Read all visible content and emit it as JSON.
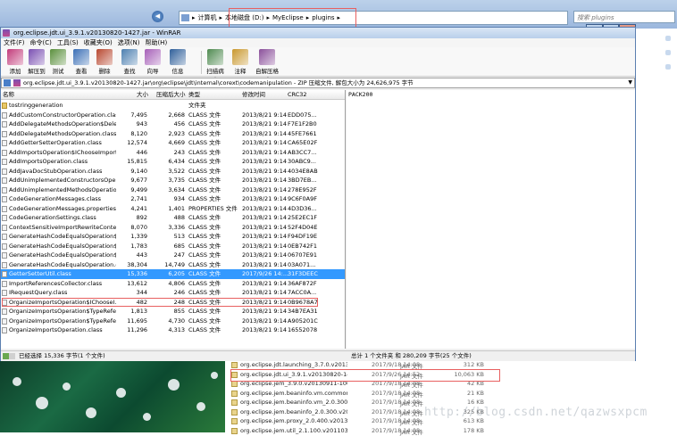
{
  "explorer": {
    "breadcrumb": [
      "计算机",
      "本地磁盘 (D:)",
      "MyEclipse",
      "plugins"
    ],
    "search_placeholder": "搜索 plugins",
    "status_line": "",
    "files": [
      {
        "name": "org.eclipse.jdt.launching_3.7.0.v20130...",
        "date": "2017/9/18 14:08",
        "type": "JAR 文件",
        "size": "312 KB"
      },
      {
        "name": "org.eclipse.jdt.ui_3.9.1.v20130820-14...",
        "date": "2017/9/26 14:52",
        "type": "JAR 文件",
        "size": "10,063 KB"
      },
      {
        "name": "org.eclipse.jem_3.9.0.v20130911-1000...",
        "date": "2017/9/18 14:08",
        "type": "JAR 文件",
        "size": "42 KB"
      },
      {
        "name": "org.eclipse.jem.beaninfo.vm.common...",
        "date": "2017/9/18 14:08",
        "type": "JAR 文件",
        "size": "21 KB"
      },
      {
        "name": "org.eclipse.jem.beaninfo.vm_2.0.300.v...",
        "date": "2017/9/18 14:08",
        "type": "JAR 文件",
        "size": "16 KB"
      },
      {
        "name": "org.eclipse.jem.beaninfo_2.0.300.v20...",
        "date": "2017/9/18 14:08",
        "type": "JAR 文件",
        "size": "325 KB"
      },
      {
        "name": "org.eclipse.jem.proxy_2.0.400.v2013...",
        "date": "2017/9/18 14:08",
        "type": "JAR 文件",
        "size": "613 KB"
      },
      {
        "name": "org.eclipse.jem.util_2.1.100.v201103...",
        "date": "2017/9/18 14:08",
        "type": "JAR 文件",
        "size": "178 KB"
      }
    ],
    "watermark": "http://blog.csdn.net/qazwsxpcm"
  },
  "rar": {
    "title": "org.eclipse.jdt.ui_3.9.1.v20130820-1427.jar - WinRAR",
    "menu": [
      "文件(F)",
      "命令(C)",
      "工具(S)",
      "收藏夹(O)",
      "选项(N)",
      "帮助(H)"
    ],
    "toolbar": [
      {
        "label": "添加",
        "color": "#c23b7a"
      },
      {
        "label": "解压到",
        "color": "#7a4fb2"
      },
      {
        "label": "测试",
        "color": "#5a8f3c"
      },
      {
        "label": "查看",
        "color": "#3b6fb6"
      },
      {
        "label": "删除",
        "color": "#b8472f"
      },
      {
        "label": "查找",
        "color": "#4c7fb0"
      },
      {
        "label": "向导",
        "color": "#a65fb8"
      },
      {
        "label": "信息",
        "color": "#2f5f9a"
      },
      {
        "label": "扫描病毒",
        "color": "#4f8a50"
      },
      {
        "label": "注释",
        "color": "#c9982e"
      },
      {
        "label": "自解压格式",
        "color": "#8a4f9a"
      }
    ],
    "path": "org.eclipse.jdt.ui_3.9.1.v20130820-1427.jar\\org\\eclipse\\jdt\\internal\\corext\\codemanipulation - ZIP 压缩文件, 解包大小为 24,626,975 字节",
    "columns": {
      "name": "名称",
      "size": "大小",
      "packed": "压缩后大小",
      "type": "类型",
      "modified": "修改时间",
      "crc": "CRC32"
    },
    "rows": [
      {
        "name": "tostringgeneration",
        "size": "",
        "packed": "",
        "type": "文件夹",
        "modified": "",
        "crc": "",
        "folder": true
      },
      {
        "name": "AddCustomConstructorOperation.class",
        "size": "7,495",
        "packed": "2,668",
        "type": "CLASS 文件",
        "modified": "2013/8/21 9:14",
        "crc": "EDD075..."
      },
      {
        "name": "AddDelegateMethodsOperation$Dele...",
        "size": "943",
        "packed": "456",
        "type": "CLASS 文件",
        "modified": "2013/8/21 9:14",
        "crc": "F7E1F2B0"
      },
      {
        "name": "AddDelegateMethodsOperation.class",
        "size": "8,120",
        "packed": "2,923",
        "type": "CLASS 文件",
        "modified": "2013/8/21 9:14",
        "crc": "45FE7661"
      },
      {
        "name": "AddGetterSetterOperation.class",
        "size": "12,574",
        "packed": "4,669",
        "type": "CLASS 文件",
        "modified": "2013/8/21 9:14",
        "crc": "CA65E02F"
      },
      {
        "name": "AddImportsOperation$IChooseImport...",
        "size": "446",
        "packed": "243",
        "type": "CLASS 文件",
        "modified": "2013/8/21 9:14",
        "crc": "AB3CC7..."
      },
      {
        "name": "AddImportsOperation.class",
        "size": "15,815",
        "packed": "6,434",
        "type": "CLASS 文件",
        "modified": "2013/8/21 9:14",
        "crc": "30ABC9..."
      },
      {
        "name": "AddJavaDocStubOperation.class",
        "size": "9,140",
        "packed": "3,522",
        "type": "CLASS 文件",
        "modified": "2013/8/21 9:14",
        "crc": "4034E8AB"
      },
      {
        "name": "AddUnimplementedConstructorsOper...",
        "size": "9,677",
        "packed": "3,735",
        "type": "CLASS 文件",
        "modified": "2013/8/21 9:14",
        "crc": "3BD7EB..."
      },
      {
        "name": "AddUnimplementedMethodsOperatio...",
        "size": "9,499",
        "packed": "3,634",
        "type": "CLASS 文件",
        "modified": "2013/8/21 9:14",
        "crc": "278E952F"
      },
      {
        "name": "CodeGenerationMessages.class",
        "size": "2,741",
        "packed": "934",
        "type": "CLASS 文件",
        "modified": "2013/8/21 9:14",
        "crc": "9C6F0A9F"
      },
      {
        "name": "CodeGenerationMessages.properties",
        "size": "4,241",
        "packed": "1,401",
        "type": "PROPERTIES 文件",
        "modified": "2013/8/21 9:14",
        "crc": "4D3D36..."
      },
      {
        "name": "CodeGenerationSettings.class",
        "size": "892",
        "packed": "488",
        "type": "CLASS 文件",
        "modified": "2013/8/21 9:14",
        "crc": "25E2EC1F"
      },
      {
        "name": "ContextSensitiveImportRewriteContext...",
        "size": "8,070",
        "packed": "3,336",
        "type": "CLASS 文件",
        "modified": "2013/8/21 9:14",
        "crc": "52F4D04E"
      },
      {
        "name": "GenerateHashCodeEqualsOperation$1...",
        "size": "1,339",
        "packed": "513",
        "type": "CLASS 文件",
        "modified": "2013/8/21 9:14",
        "crc": "F94DF19E"
      },
      {
        "name": "GenerateHashCodeEqualsOperation$2...",
        "size": "1,783",
        "packed": "685",
        "type": "CLASS 文件",
        "modified": "2013/8/21 9:14",
        "crc": "0EB742F1"
      },
      {
        "name": "GenerateHashCodeEqualsOperation$1...",
        "size": "443",
        "packed": "247",
        "type": "CLASS 文件",
        "modified": "2013/8/21 9:14",
        "crc": "06707E91"
      },
      {
        "name": "GenerateHashCodeEqualsOperation.cl...",
        "size": "38,304",
        "packed": "14,749",
        "type": "CLASS 文件",
        "modified": "2013/8/21 9:14",
        "crc": "03A071..."
      },
      {
        "name": "GetterSetterUtil.class",
        "size": "15,336",
        "packed": "6,205",
        "type": "CLASS 文件",
        "modified": "2017/9/26 14:...",
        "crc": "31F3DEEC",
        "selected": true
      },
      {
        "name": "ImportReferencesCollector.class",
        "size": "13,612",
        "packed": "4,806",
        "type": "CLASS 文件",
        "modified": "2013/8/21 9:14",
        "crc": "36AF872F"
      },
      {
        "name": "IRequestQuery.class",
        "size": "344",
        "packed": "246",
        "type": "CLASS 文件",
        "modified": "2013/8/21 9:14",
        "crc": "7ACC0A..."
      },
      {
        "name": "OrganizeImportsOperation$IChooseI...",
        "size": "482",
        "packed": "248",
        "type": "CLASS 文件",
        "modified": "2013/8/21 9:14",
        "crc": "0B9678A7"
      },
      {
        "name": "OrganizeImportsOperation$TypeRefer...",
        "size": "1,813",
        "packed": "855",
        "type": "CLASS 文件",
        "modified": "2013/8/21 9:14",
        "crc": "34B7EA31"
      },
      {
        "name": "OrganizeImportsOperation$TypeRefer...",
        "size": "11,695",
        "packed": "4,730",
        "type": "CLASS 文件",
        "modified": "2013/8/21 9:14",
        "crc": "A905201C"
      },
      {
        "name": "OrganizeImportsOperation.class",
        "size": "11,296",
        "packed": "4,313",
        "type": "CLASS 文件",
        "modified": "2013/8/21 9:14",
        "crc": "16552078"
      }
    ],
    "comment": "PACK200",
    "status_left": "已经选择 15,336 字节(1 个文件)",
    "status_right": "总计 1 个文件夹 和 280,209 字节(25 个文件)"
  }
}
